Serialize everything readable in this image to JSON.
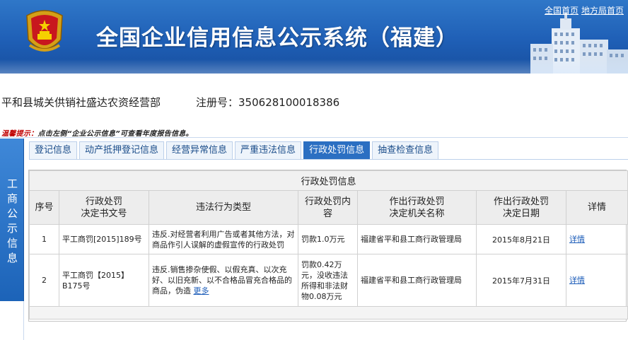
{
  "header": {
    "site_title": "全国企业信用信息公示系统（福建）",
    "link_home": "全国首页",
    "link_local": "地方局首页"
  },
  "company": {
    "name": "平和县城关供销社盛达农资经营部",
    "reg_no": "注册号：350628100018386"
  },
  "warning": {
    "prefix": "温馨提示：",
    "text": "点击左侧“企业公示信息”可查看年度报告信息。"
  },
  "side_tab": {
    "label": "工商公示信息"
  },
  "tabs": [
    {
      "label": "登记信息",
      "active": false
    },
    {
      "label": "动产抵押登记信息",
      "active": false
    },
    {
      "label": "经营异常信息",
      "active": false
    },
    {
      "label": "严重违法信息",
      "active": false
    },
    {
      "label": "行政处罚信息",
      "active": true
    },
    {
      "label": "抽查检查信息",
      "active": false
    }
  ],
  "table": {
    "caption": "行政处罚信息",
    "headers": {
      "seq": "序号",
      "doc_no": "行政处罚\n决定书文号",
      "violation": "违法行为类型",
      "content": "行政处罚内\n容",
      "authority": "作出行政处罚\n决定机关名称",
      "date": "作出行政处罚\n决定日期",
      "detail": "详情"
    },
    "rows": [
      {
        "seq": "1",
        "doc_no": "平工商罚[2015]189号",
        "violation": "违反.对经营者利用广告或者其他方法，对商品作引人误解的虚假宣传的行政处罚",
        "more": "",
        "content": "罚款1.0万元",
        "authority": "福建省平和县工商行政管理局",
        "date": "2015年8月21日",
        "detail": "详情"
      },
      {
        "seq": "2",
        "doc_no": "平工商罚【2015】B175号",
        "violation": "违反.销售掺杂使假、以假充真、以次充好、以旧充新、以不合格品冒充合格品的商品，伪造",
        "more": "更多",
        "content": "罚款0.42万元，没收违法所得和非法财物0.08万元",
        "authority": "福建省平和县工商行政管理局",
        "date": "2015年7月31日",
        "detail": "详情"
      }
    ]
  },
  "colors": {
    "banner": "#1f5fb6",
    "tab_active": "#2b6fc2",
    "link": "#1a5bb8",
    "warning_prefix": "#c00000"
  }
}
